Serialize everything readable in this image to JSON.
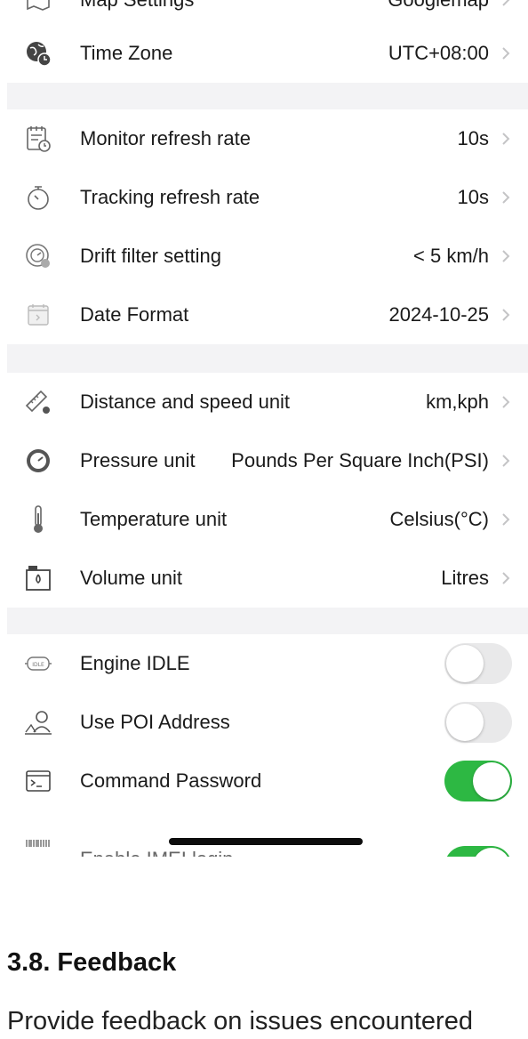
{
  "settings": {
    "partial_top": {
      "label": "Map Settings",
      "value": "Googlemap"
    },
    "group1": [
      {
        "label": "Time Zone",
        "value": "UTC+08:00",
        "icon": "globe-clock-icon"
      }
    ],
    "group2": [
      {
        "label": "Monitor refresh rate",
        "value": "10s",
        "icon": "calendar-clock-icon"
      },
      {
        "label": "Tracking refresh rate",
        "value": "10s",
        "icon": "stopwatch-icon"
      },
      {
        "label": "Drift filter setting",
        "value": "< 5 km/h",
        "icon": "drift-filter-icon"
      },
      {
        "label": "Date Format",
        "value": "2024-10-25",
        "icon": "calendar-icon"
      }
    ],
    "group3": [
      {
        "label": "Distance and speed unit",
        "value": "km,kph",
        "icon": "ruler-gear-icon"
      },
      {
        "label": "Pressure unit",
        "value": "Pounds Per Square Inch(PSI)",
        "icon": "gauge-icon"
      },
      {
        "label": "Temperature unit",
        "value": "Celsius(°C)",
        "icon": "thermometer-icon"
      },
      {
        "label": "Volume unit",
        "value": "Litres",
        "icon": "fuel-can-icon"
      }
    ],
    "group4": [
      {
        "label": "Engine IDLE",
        "state": "off",
        "icon": "engine-idle-icon"
      },
      {
        "label": "Use POI Address",
        "state": "off",
        "icon": "poi-person-icon"
      },
      {
        "label": "Command Password",
        "state": "on",
        "icon": "terminal-icon"
      },
      {
        "label": "Enable IMEI login",
        "state": "on",
        "icon": "barcode-icon"
      }
    ]
  },
  "doc": {
    "heading": "3.8. Feedback",
    "body": "Provide feedback on issues encountered"
  },
  "colors": {
    "toggle_on": "#2db843",
    "toggle_off": "#e9e9ea",
    "section_gap": "#f3f3f5"
  }
}
